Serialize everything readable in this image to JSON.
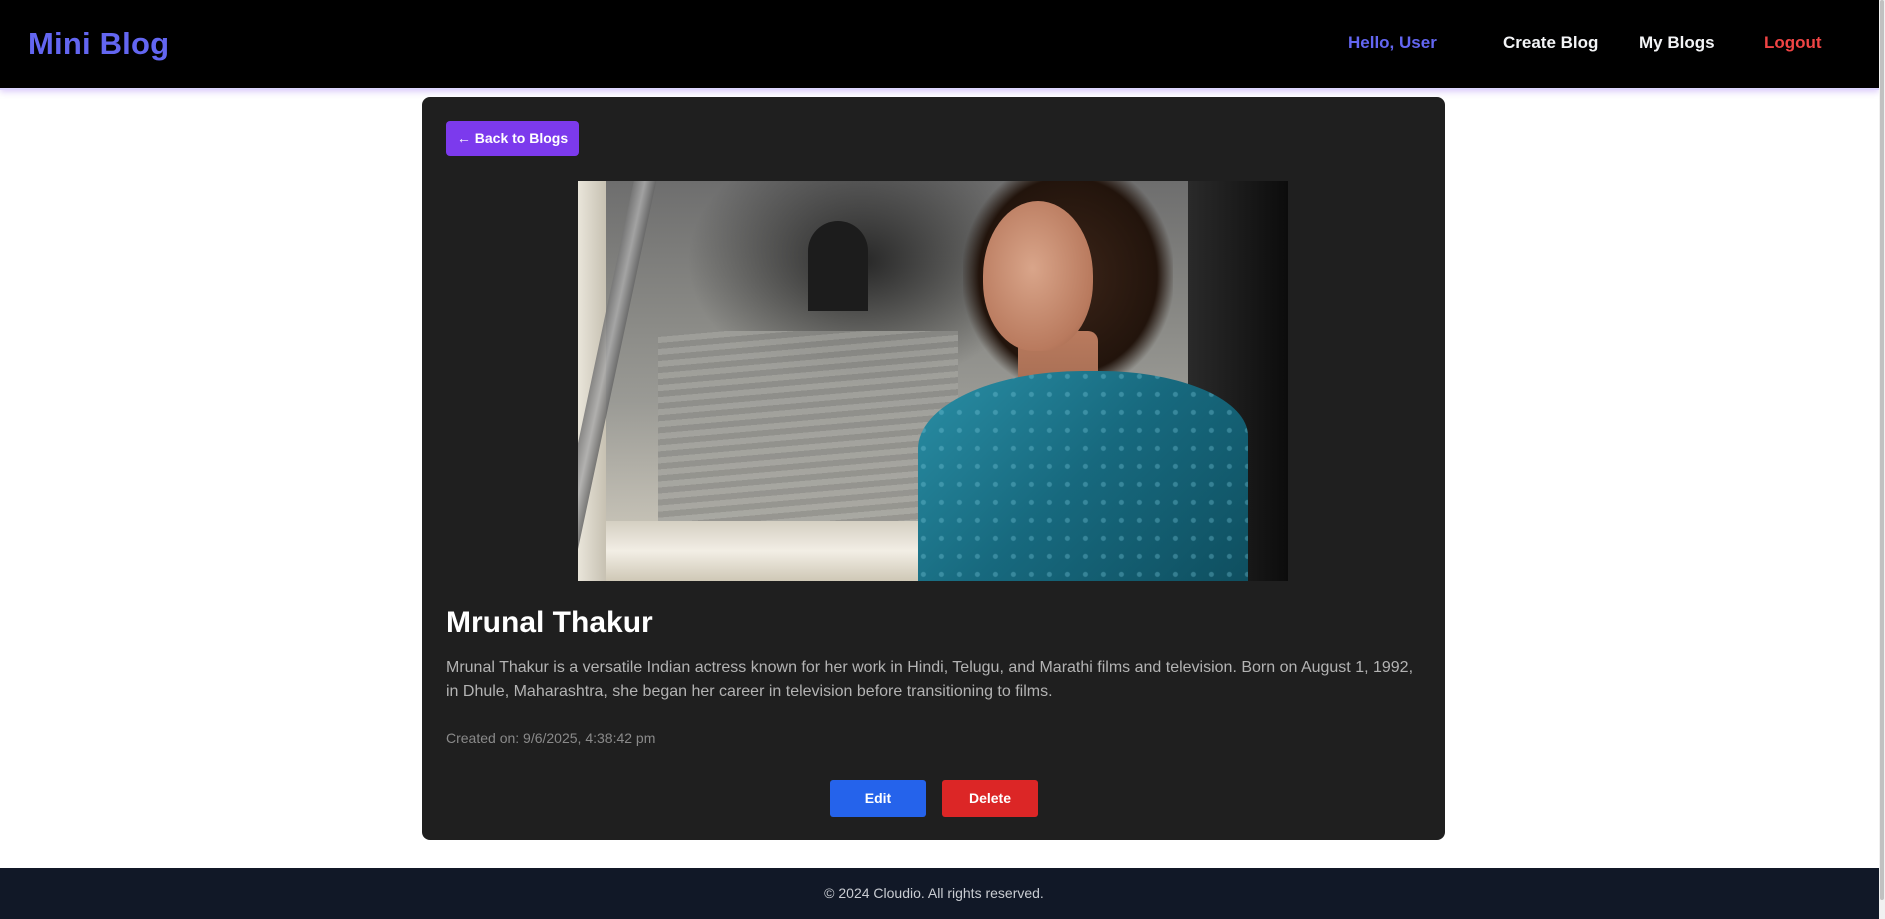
{
  "header": {
    "brand": "Mini Blog",
    "greeting": "Hello, User",
    "nav": {
      "create": "Create Blog",
      "mine": "My Blogs",
      "logout": "Logout"
    }
  },
  "post": {
    "back_label": "← Back to Blogs",
    "title": "Mrunal Thakur",
    "content": "Mrunal Thakur is a versatile Indian actress known for her work in Hindi, Telugu, and Marathi films and television. Born on August 1, 1992, in Dhule, Maharashtra, she began her career in television before transitioning to films.",
    "created": "Created on: 9/6/2025, 4:38:42 pm",
    "actions": {
      "edit": "Edit",
      "delete": "Delete"
    }
  },
  "footer": {
    "copyright": "© 2024 Cloudio. All rights reserved."
  },
  "colors": {
    "brand": "#6366f1",
    "back_button": "#7c3aed",
    "edit_button": "#2563eb",
    "delete_button": "#dc2626",
    "logout": "#ef4444"
  }
}
